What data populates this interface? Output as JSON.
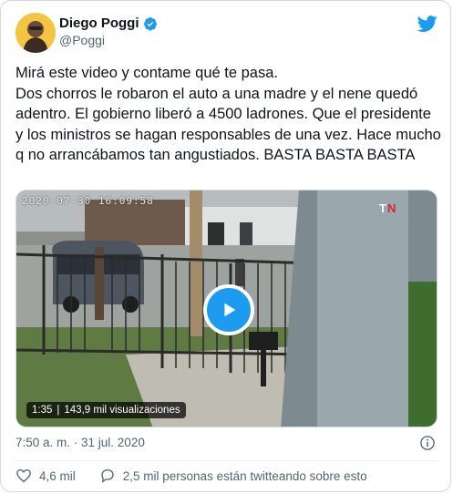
{
  "author": {
    "display_name": "Diego Poggi",
    "handle": "@Poggi"
  },
  "tweet": {
    "text": "Mirá este video y contame qué te pasa.\nDos chorros le robaron el auto a una madre y el nene quedó adentro. El gobierno liberó a 4500 ladrones. Que el presidente y los ministros se hagan responsables de una vez. Hace mucho q no arrancábamos tan angustiados. BASTA BASTA BASTA",
    "posted_at": "7:50 a. m. · 31 jul. 2020"
  },
  "video": {
    "camera_timestamp": "2020-07-30  16:09:58",
    "duration": "1:35",
    "separator": "|",
    "views": "143,9 mil visualizaciones"
  },
  "actions": {
    "likes": "4,6 mil",
    "conversation": "2,5 mil personas están twitteando sobre esto"
  },
  "colors": {
    "accent": "#1d9bf0",
    "secondary_text": "#536471",
    "like_red": "#f4212e"
  },
  "icons": [
    "verified-badge-icon",
    "twitter-bird-icon",
    "play-icon",
    "tn-logo-icon",
    "info-icon",
    "heart-icon",
    "speech-bubble-icon"
  ]
}
